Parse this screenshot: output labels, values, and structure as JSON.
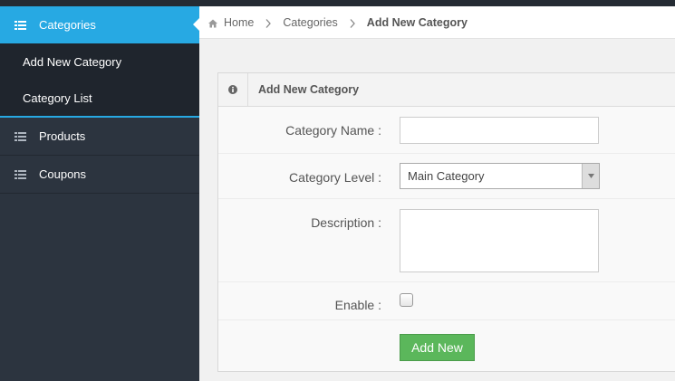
{
  "colors": {
    "accent": "#27a9e3",
    "sidebar_bg": "#2c343f",
    "submenu_bg": "#1f252d",
    "button_green": "#5bb75b"
  },
  "sidebar": {
    "items": [
      {
        "label": "Categories",
        "icon": "list-icon",
        "active": true,
        "children": [
          {
            "label": "Add New Category"
          },
          {
            "label": "Category List"
          }
        ]
      },
      {
        "label": "Products",
        "icon": "list-icon"
      },
      {
        "label": "Coupons",
        "icon": "list-icon"
      }
    ]
  },
  "breadcrumb": {
    "home_icon": "home-icon",
    "items": [
      "Home",
      "Categories",
      "Add New Category"
    ]
  },
  "panel": {
    "icon": "info-icon",
    "title": "Add New Category"
  },
  "form": {
    "category_name": {
      "label": "Category Name :",
      "value": ""
    },
    "category_level": {
      "label": "Category Level :",
      "selected": "Main Category"
    },
    "description": {
      "label": "Description :",
      "value": ""
    },
    "enable": {
      "label": "Enable :",
      "checked": false
    },
    "submit_label": "Add New"
  }
}
